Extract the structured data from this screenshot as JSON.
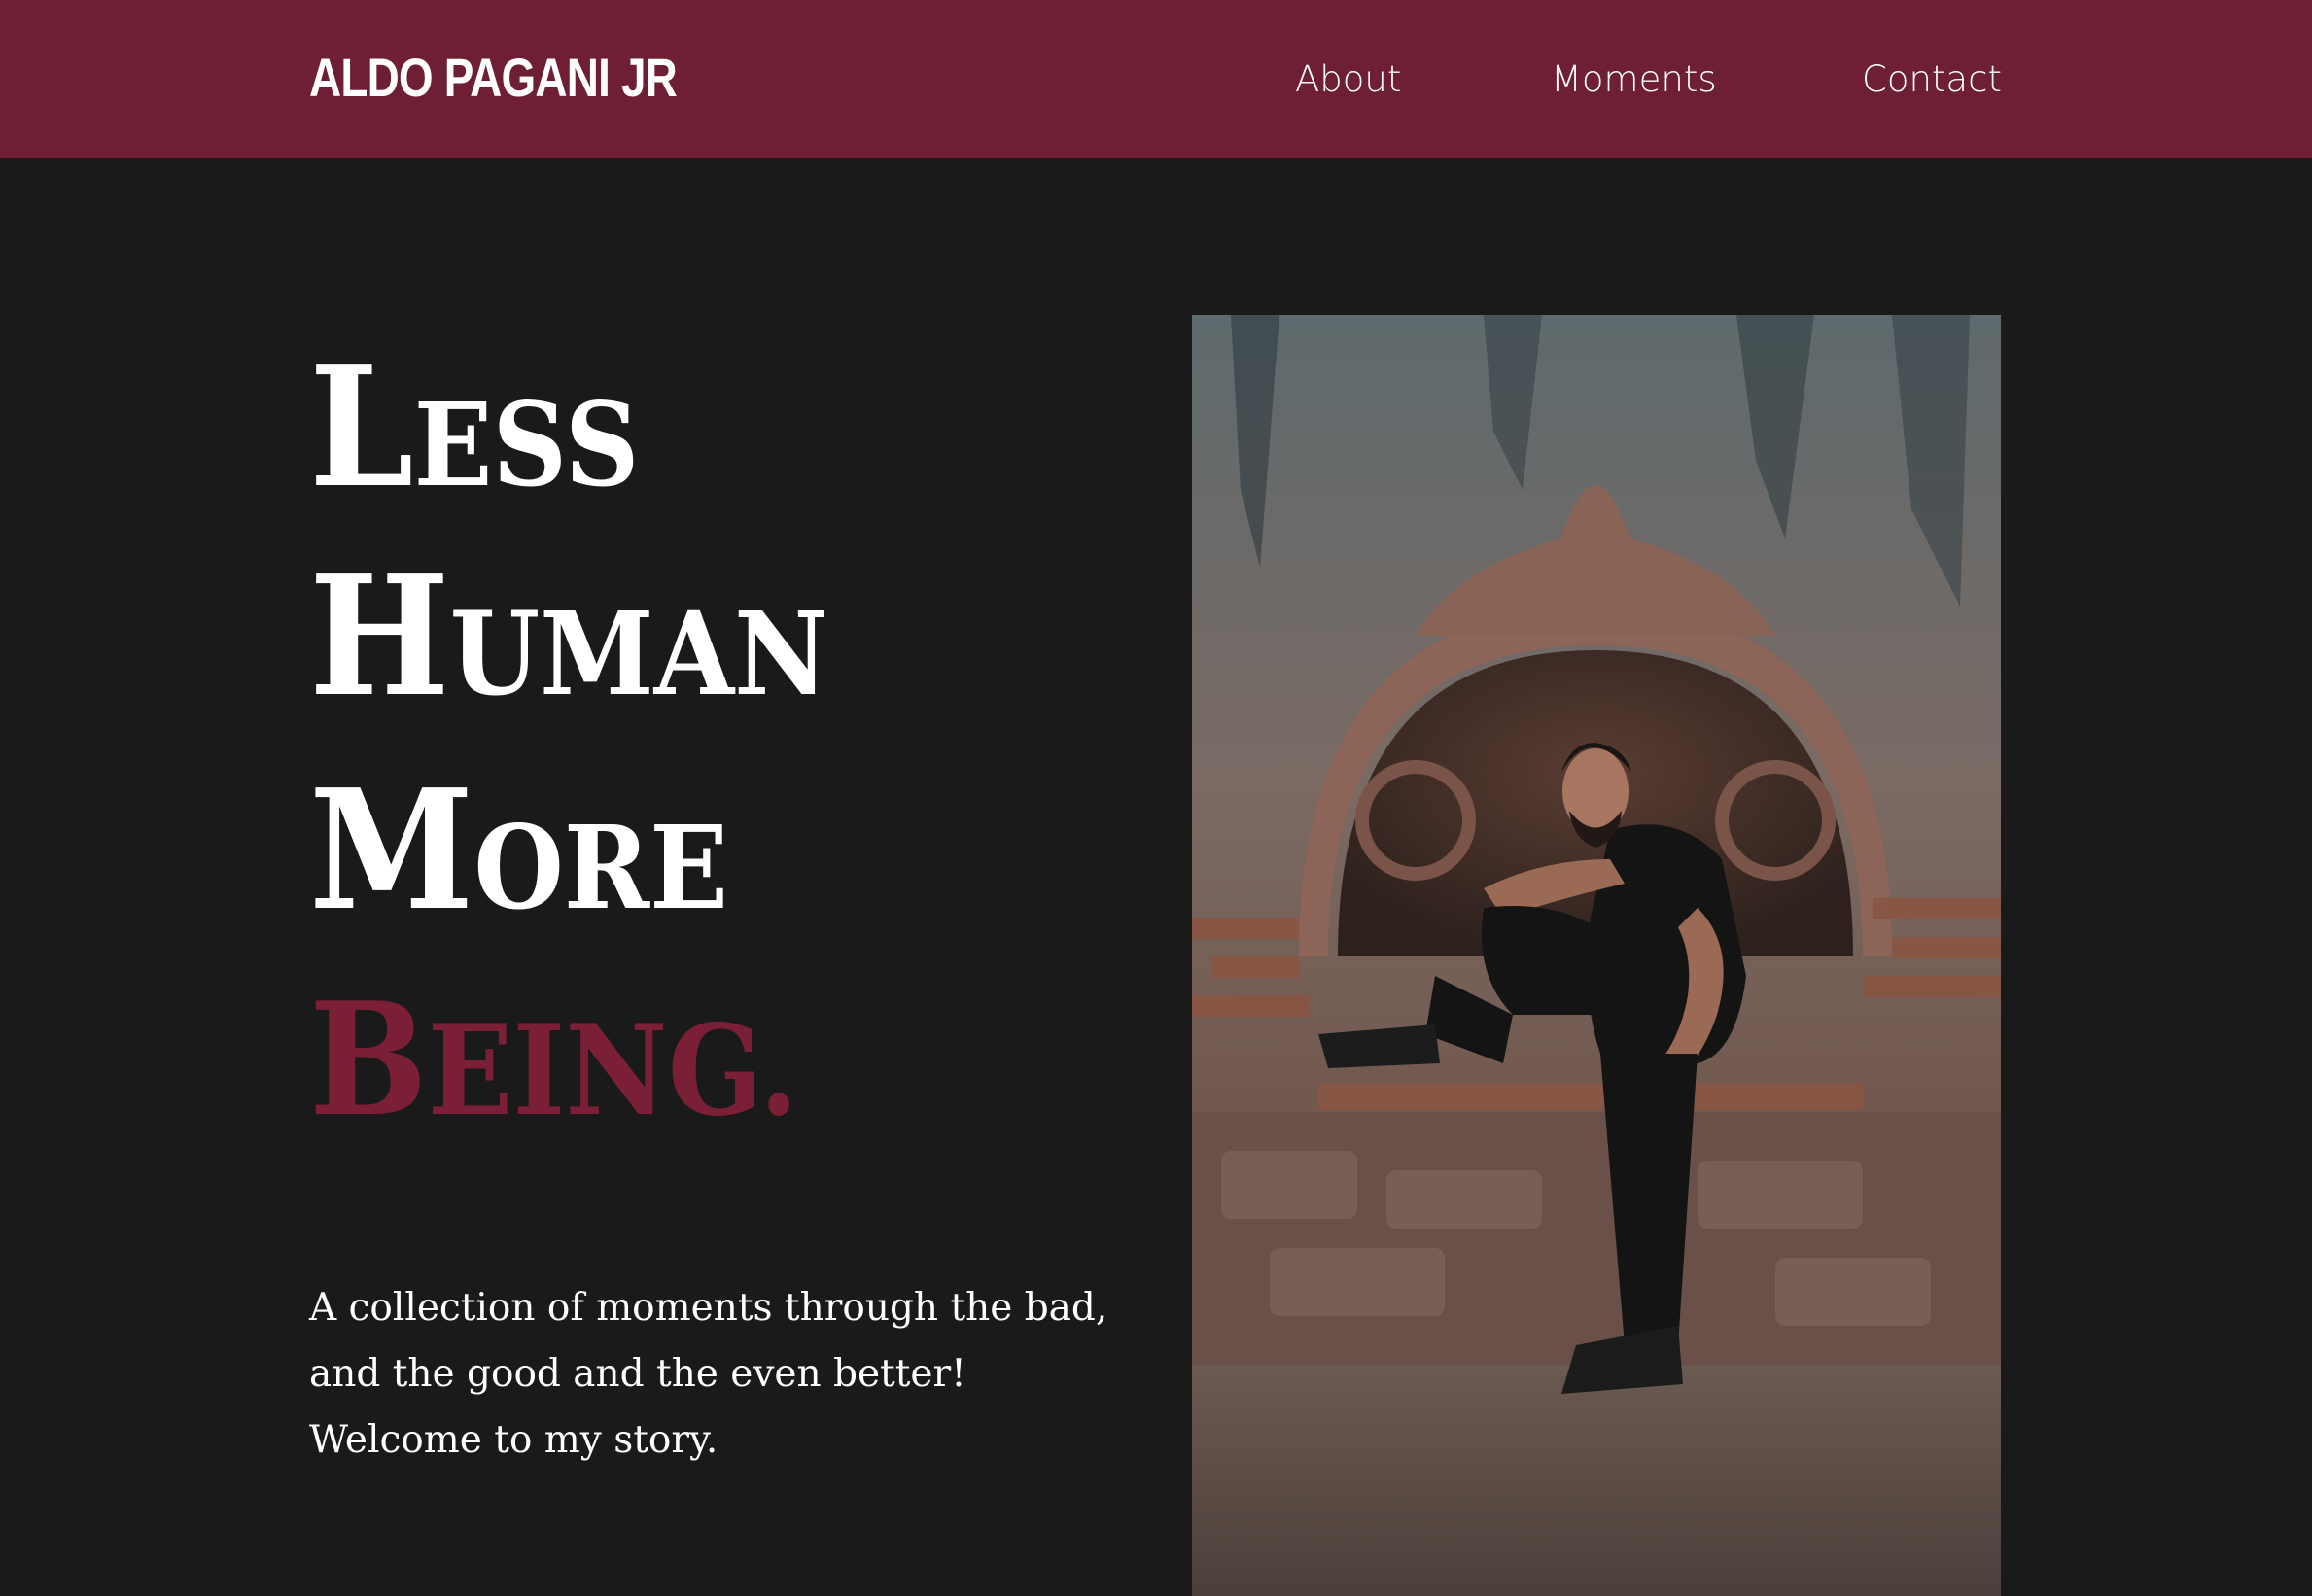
{
  "header": {
    "brand": "ALDO PAGANI JR",
    "nav": [
      {
        "label": "About"
      },
      {
        "label": "Moments"
      },
      {
        "label": "Contact"
      }
    ]
  },
  "hero": {
    "headline": [
      {
        "cap": "L",
        "rest": "ESS"
      },
      {
        "cap": "H",
        "rest": "UMAN"
      },
      {
        "cap": "M",
        "rest": "ORE"
      },
      {
        "cap": "B",
        "rest": "EING."
      }
    ],
    "intro_lines": [
      "A collection of moments through the bad,",
      "and the good and the even better!",
      "Welcome to my story."
    ]
  },
  "colors": {
    "header_bg": "#6f1f33",
    "page_bg": "#1a1a1b",
    "accent": "#7a1f36",
    "text": "#ffffff"
  }
}
